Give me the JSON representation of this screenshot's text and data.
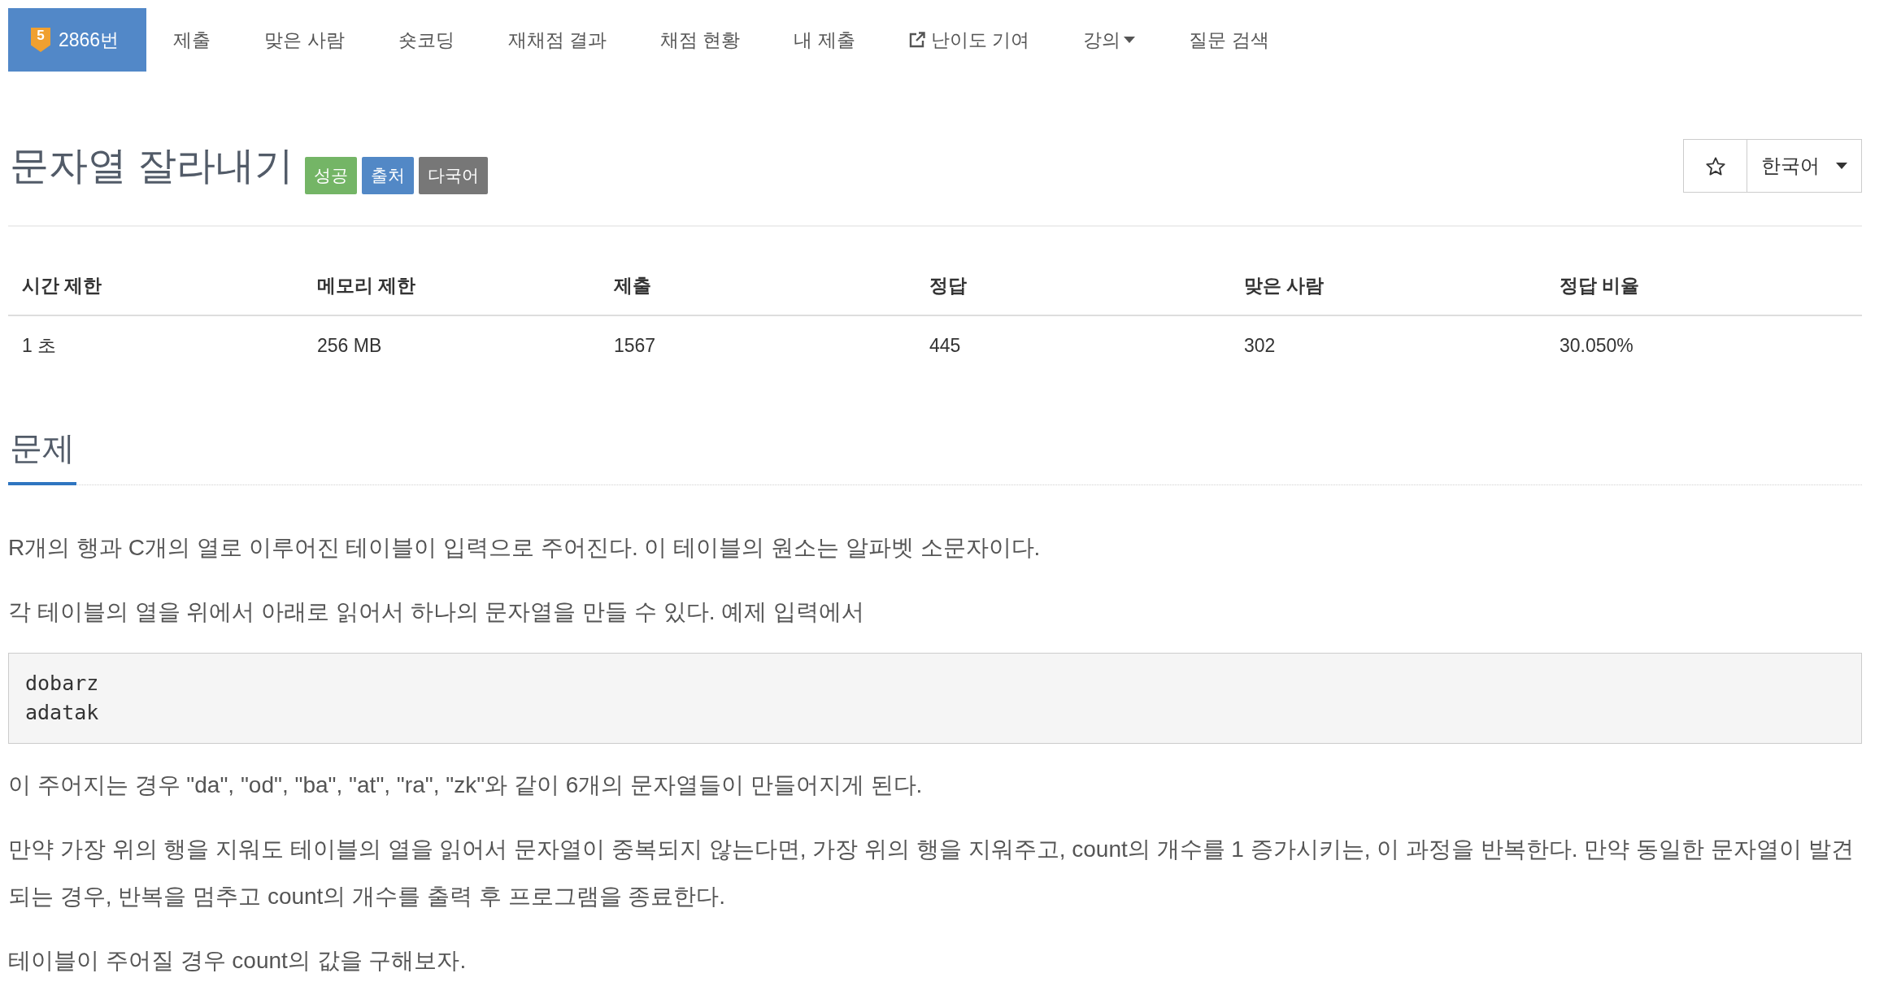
{
  "nav": {
    "tabs": [
      {
        "kind": "problem",
        "label": "2866번",
        "tier": "5",
        "selected": true
      },
      {
        "kind": "plain",
        "label": "제출",
        "selected": false
      },
      {
        "kind": "plain",
        "label": "맞은 사람",
        "selected": false
      },
      {
        "kind": "plain",
        "label": "숏코딩",
        "selected": false
      },
      {
        "kind": "plain",
        "label": "재채점 결과",
        "selected": false
      },
      {
        "kind": "plain",
        "label": "채점 현황",
        "selected": false
      },
      {
        "kind": "plain",
        "label": "내 제출",
        "selected": false
      },
      {
        "kind": "external",
        "label": "난이도 기여",
        "selected": false
      },
      {
        "kind": "menu",
        "label": "강의",
        "selected": false
      },
      {
        "kind": "plain",
        "label": "질문 검색",
        "selected": false
      }
    ]
  },
  "problem": {
    "title": "문자열 잘라내기",
    "labels": [
      {
        "text": "성공",
        "color": "#74b566"
      },
      {
        "text": "출처",
        "color": "#5288c6"
      },
      {
        "text": "다국어",
        "color": "#777777"
      }
    ],
    "starred": false,
    "language": "한국어"
  },
  "info_table": {
    "columns": [
      "시간 제한",
      "메모리 제한",
      "제출",
      "정답",
      "맞은 사람",
      "정답 비율"
    ],
    "rows": [
      [
        "1 초",
        "256 MB",
        "1567",
        "445",
        "302",
        "30.050%"
      ]
    ]
  },
  "section": {
    "title": "문제",
    "content": [
      {
        "kind": "paragraph",
        "text": "R개의 행과 C개의 열로 이루어진 테이블이 입력으로 주어진다. 이 테이블의 원소는 알파벳 소문자이다."
      },
      {
        "kind": "paragraph",
        "text": "각 테이블의 열을 위에서 아래로 읽어서 하나의 문자열을 만들 수 있다. 예제 입력에서"
      },
      {
        "kind": "code",
        "lines": [
          "dobarz",
          "adatak"
        ]
      },
      {
        "kind": "paragraph",
        "text": "이 주어지는 경우 \"da\", \"od\", \"ba\", \"at\", \"ra\", \"zk\"와 같이 6개의 문자열들이 만들어지게 된다."
      },
      {
        "kind": "paragraph",
        "text": "만약 가장 위의 행을 지워도 테이블의 열을 읽어서 문자열이 중복되지 않는다면, 가장 위의 행을 지워주고, count의 개수를 1 증가시키는, 이 과정을 반복한다. 만약 동일한 문자열이 발견되는 경우, 반복을 멈추고 count의 개수를 출력 후 프로그램을 종료한다."
      },
      {
        "kind": "paragraph",
        "text": "테이블이 주어질 경우 count의 값을 구해보자."
      }
    ]
  }
}
